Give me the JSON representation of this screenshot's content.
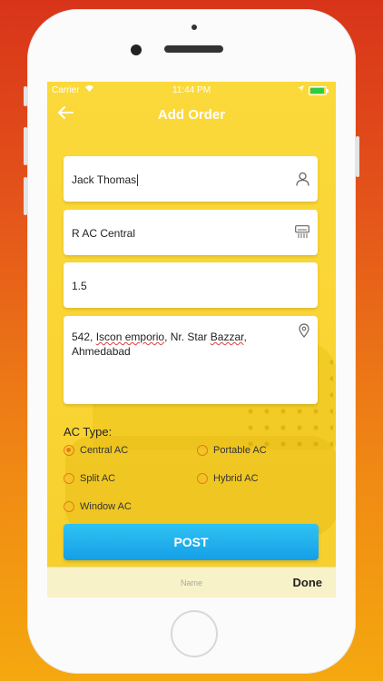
{
  "status_bar": {
    "carrier": "Carrier",
    "time": "11:44 PM"
  },
  "nav": {
    "title": "Add Order"
  },
  "form": {
    "name_value": "Jack Thomas",
    "product_value": "R AC Central",
    "ton_value": "1.5",
    "address_line1_parts": [
      "542, ",
      "Iscon emporio",
      ", Nr. Star ",
      "Bazzar",
      ","
    ],
    "address_line2": "Ahmedabad"
  },
  "ac_type": {
    "label": "AC Type:",
    "options": [
      "Central AC",
      "Portable AC",
      "Split AC",
      "Hybrid AC",
      "Window AC"
    ],
    "selected": "Central AC"
  },
  "post_label": "POST",
  "keyboard_bar": {
    "field_name": "Name",
    "done_label": "Done"
  },
  "colors": {
    "accent": "#e87a1a",
    "button": "#1ba8ec",
    "screen_bg": "#fbd93a"
  }
}
